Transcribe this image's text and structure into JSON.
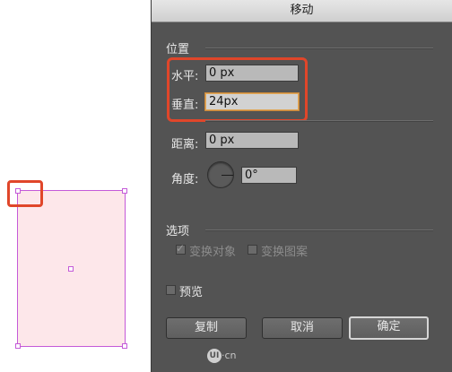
{
  "dialog": {
    "title": "移动",
    "position_group": {
      "title": "位置",
      "horizontal": {
        "label": "水平:",
        "value": "0 px"
      },
      "vertical": {
        "label": "垂直:",
        "value": "24px"
      },
      "distance": {
        "label": "距离:",
        "value": "0 px"
      },
      "angle": {
        "label": "角度:",
        "value": "0°"
      }
    },
    "options_group": {
      "title": "选项",
      "transform_objects": {
        "label": "变换对象",
        "checked": true,
        "enabled": false
      },
      "transform_patterns": {
        "label": "变换图案",
        "checked": false,
        "enabled": false
      }
    },
    "preview": {
      "label": "预览",
      "checked": false
    },
    "buttons": {
      "copy": "复制",
      "cancel": "取消",
      "ok": "确定"
    }
  },
  "watermark": {
    "logo": "UI",
    "text": "·cn"
  },
  "colors": {
    "dialog_bg": "#535353",
    "highlight": "#e0462a",
    "selection": "#c45ad8",
    "shape_fill": "#fde7ea"
  }
}
